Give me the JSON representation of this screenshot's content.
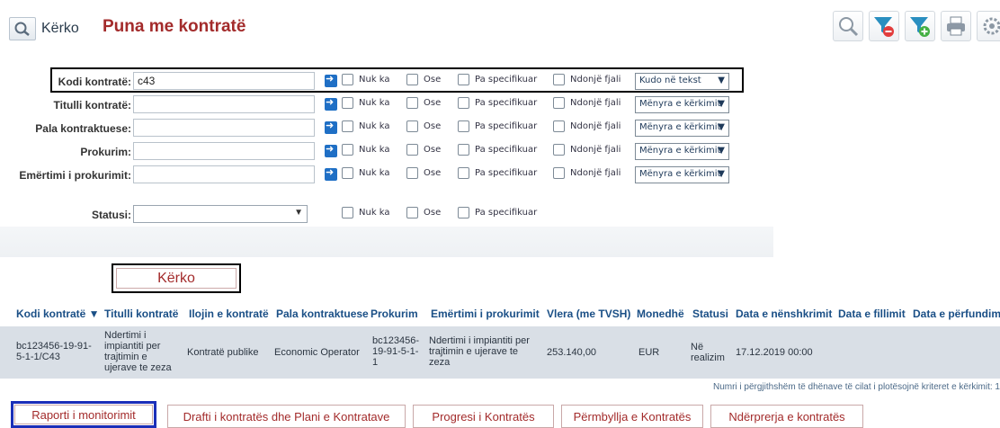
{
  "header": {
    "search_label": "Kërko",
    "title": "Puna me kontratë"
  },
  "toolbar": {
    "icons": [
      "magnifier-icon",
      "filter-remove-icon",
      "filter-add-icon",
      "print-icon",
      "settings-search-icon"
    ]
  },
  "filters": {
    "rows": [
      {
        "label": "Kodi kontratë:",
        "value": "c43",
        "mode": "Kudo në tekst"
      },
      {
        "label": "Titulli kontratë:",
        "value": "",
        "mode": "Mënyra e kërkimit"
      },
      {
        "label": "Pala kontraktuese:",
        "value": "",
        "mode": "Mënyra e kërkimit"
      },
      {
        "label": "Prokurim:",
        "value": "",
        "mode": "Mënyra e kërkimit"
      },
      {
        "label": "Emërtimi i prokurimit:",
        "value": "",
        "mode": "Mënyra e kërkimit"
      }
    ],
    "status_label": "Statusi:",
    "options": {
      "nuk_ka": "Nuk ka",
      "ose": "Ose",
      "pa_specifikuar": "Pa specifikuar",
      "ndonje_fjali": "Ndonjë fjali"
    },
    "submit_label": "Kërko"
  },
  "table": {
    "headers": [
      "Kodi kontratë ▼",
      "Titulli kontratë",
      "Ilojin e kontratë",
      "Pala kontraktuese",
      "Prokurim",
      "Emërtimi i prokurimit",
      "Vlera (me TVSH)",
      "Monedhë",
      "Statusi",
      "Data e nënshkrimit",
      "Data e fillimit",
      "Data e përfundimi"
    ],
    "row": {
      "kodi_line1": "bc123456-19-91-",
      "kodi_line2": "5-1-1/C43",
      "titulli_line1": "Ndertimi i",
      "titulli_line2": "impiantiti per",
      "titulli_line3": "trajtimin e",
      "titulli_line4": "ujerave te zeza",
      "lloji": "Kontratë publike",
      "pala": "Economic Operator",
      "prokurim_line1": "bc123456-",
      "prokurim_line2": "19-91-5-1-",
      "prokurim_line3": "1",
      "emertimi_line1": "Ndertimi i impiantiti per",
      "emertimi_line2": "trajtimin e ujerave te",
      "emertimi_line3": "zeza",
      "vlera": "253.140,00",
      "monedhe": "EUR",
      "statusi_line1": "Në",
      "statusi_line2": "realizim",
      "data_nenshkrimit": "17.12.2019 00:00"
    },
    "total_text": "Numri i përgjithshëm të dhënave të cilat i plotësojnë kriteret e kërkimit: 1"
  },
  "actions": [
    "Raporti i monitorimit",
    "Drafti i kontratës dhe Plani e Kontratave",
    "Progresi i Kontratës",
    "Përmbyllja e Kontratës",
    "Ndërprerja e kontratës"
  ]
}
